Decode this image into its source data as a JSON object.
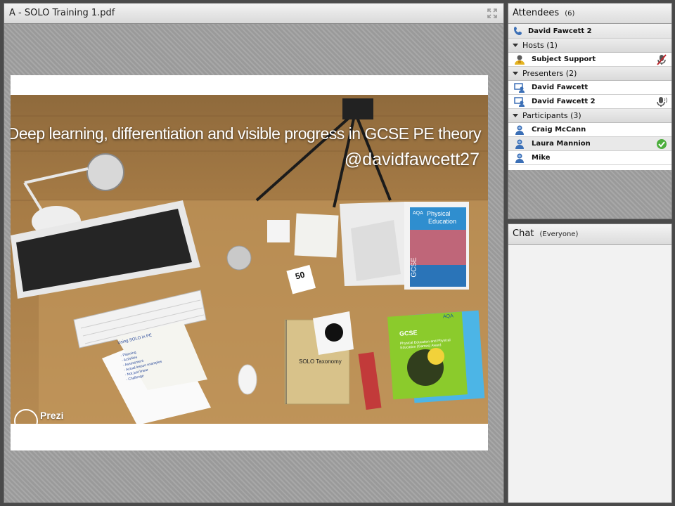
{
  "share_pod": {
    "title": "A - SOLO Training 1.pdf",
    "icons": {
      "fullscreen": "fullscreen-expand-icon"
    },
    "slide": {
      "title": "Deep learning, differentiation and visible progress in GCSE PE theory",
      "handle": "@davidfawcett27",
      "watermark": "Prezi",
      "props": {
        "card_number": "50",
        "notebook_heading": "SOLO Taxonomy",
        "paper_heading": "Using SOLO in PE",
        "paper_lines": [
          "- Planning",
          "- Activities",
          "- Assessment",
          "- Actual lesson examples",
          "- Not just linear",
          "- Challenge"
        ],
        "book_top_brand": "AQA",
        "book_top_title_1": "Physical",
        "book_top_title_2": "Education",
        "book_top_spine": "GCSE",
        "book_bottom_brand": "AQA",
        "book_bottom_label": "GCSE",
        "book_bottom_title": "Physical Education and Physical Education (Games) Award"
      }
    }
  },
  "attendees": {
    "title": "Attendees",
    "count": "(6)",
    "current_user": {
      "name": "David Fawcett 2",
      "icon": "phone-icon"
    },
    "groups": [
      {
        "label": "Hosts (1)",
        "members": [
          {
            "name": "Subject Support",
            "icon": "host-icon",
            "status_icon": "microphone-muted-icon"
          }
        ]
      },
      {
        "label": "Presenters (2)",
        "members": [
          {
            "name": "David Fawcett",
            "icon": "presenter-icon"
          },
          {
            "name": "David Fawcett 2",
            "icon": "presenter-icon",
            "status_icon": "microphone-speaking-icon"
          }
        ]
      },
      {
        "label": "Participants (3)",
        "members": [
          {
            "name": "Craig McCann",
            "icon": "participant-icon"
          },
          {
            "name": "Laura Mannion",
            "icon": "participant-icon",
            "status_icon": "agree-check-icon"
          },
          {
            "name": "Mike",
            "icon": "participant-icon"
          }
        ]
      }
    ]
  },
  "chat": {
    "title": "Chat",
    "scope": "(Everyone)"
  },
  "colors": {
    "share_background": "#a4a4a4",
    "participant_blue": "#3b6fb6",
    "host_yellow": "#e4b422",
    "agree_green": "#4cae3c",
    "mic_red": "#c0272d"
  }
}
